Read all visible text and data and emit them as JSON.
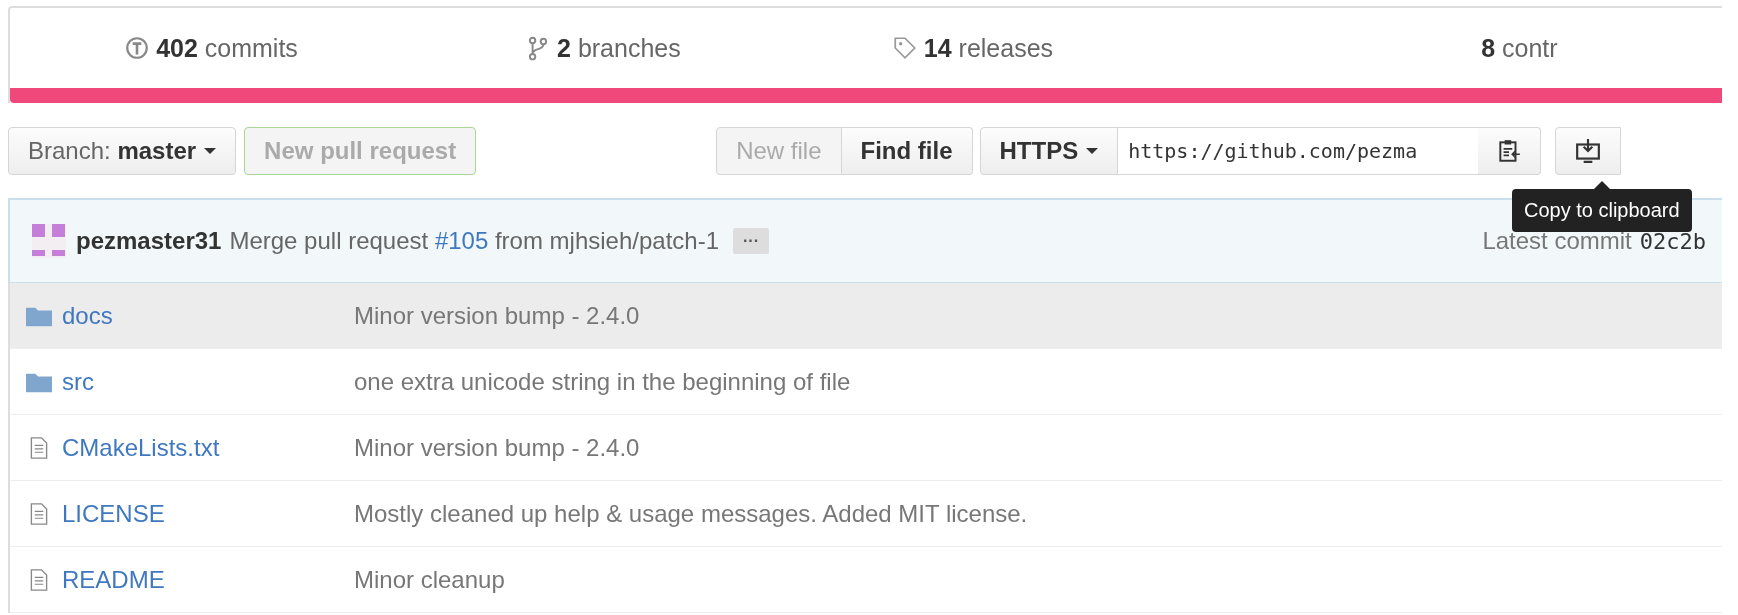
{
  "stats": [
    {
      "kind": "commits",
      "count": "402",
      "label": "commits"
    },
    {
      "kind": "branches",
      "count": "2",
      "label": "branches"
    },
    {
      "kind": "releases",
      "count": "14",
      "label": "releases"
    },
    {
      "kind": "contributors",
      "count": "8",
      "label": "contr"
    }
  ],
  "toolbar": {
    "branch_label": "Branch:",
    "branch": "master",
    "pull_request": {
      "label": "New pull request",
      "disabled": true
    },
    "new_file": {
      "label": "New file",
      "disabled": true
    },
    "find_file": "Find file",
    "protocol": "HTTPS",
    "clone_url": "https://github.com/pezma",
    "tooltip": "Copy to clipboard"
  },
  "commit": {
    "author": "pezmaster31",
    "message_before": "Merge pull request",
    "pr_link": "#105",
    "message_after": "from mjhsieh/patch-1",
    "ellipsis": "···",
    "latest_label": "Latest commit",
    "sha": "02c2b"
  },
  "files": [
    {
      "kind": "folder",
      "name": "docs",
      "message": "Minor version bump - 2.4.0",
      "selected": true
    },
    {
      "kind": "folder",
      "name": "src",
      "message": "one extra unicode string in the beginning of file",
      "selected": false
    },
    {
      "kind": "file",
      "name": "CMakeLists.txt",
      "message": "Minor version bump - 2.4.0",
      "selected": false
    },
    {
      "kind": "file",
      "name": "LICENSE",
      "message": "Mostly cleaned up help & usage messages. Added MIT license.",
      "selected": false
    },
    {
      "kind": "file",
      "name": "README",
      "message": "Minor cleanup",
      "selected": false
    }
  ]
}
